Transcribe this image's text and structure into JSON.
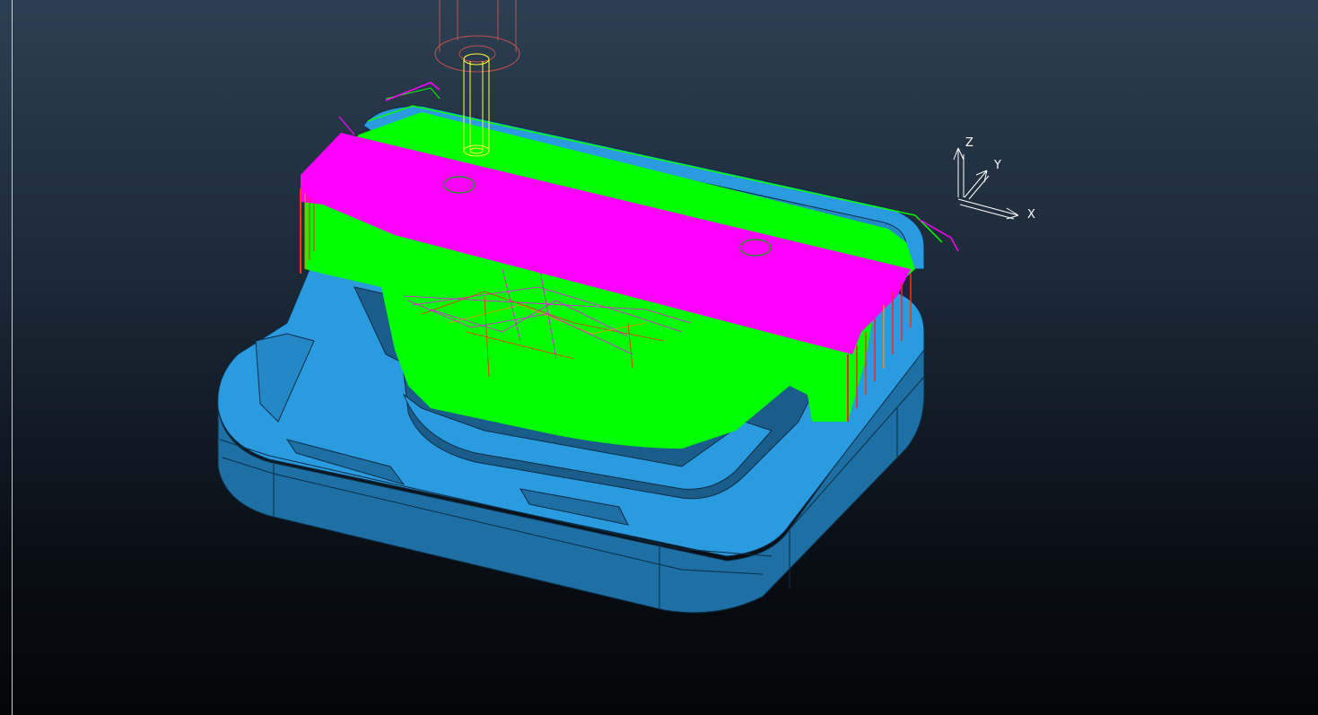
{
  "viewport": {
    "background_top": "#2d3f52",
    "background_bottom": "#030508"
  },
  "colors": {
    "part_blue": "#2b9be0",
    "part_blue_dark": "#1e6fa3",
    "toolpath_green": "#00ff00",
    "toolpath_magenta": "#ff00ff",
    "tool_yellow": "#ffff33",
    "holder_red": "#c0504d",
    "lead_red": "#ff2020"
  },
  "axis_triad": {
    "z_label": "Z",
    "y_label": "Y",
    "x_label": "X"
  }
}
